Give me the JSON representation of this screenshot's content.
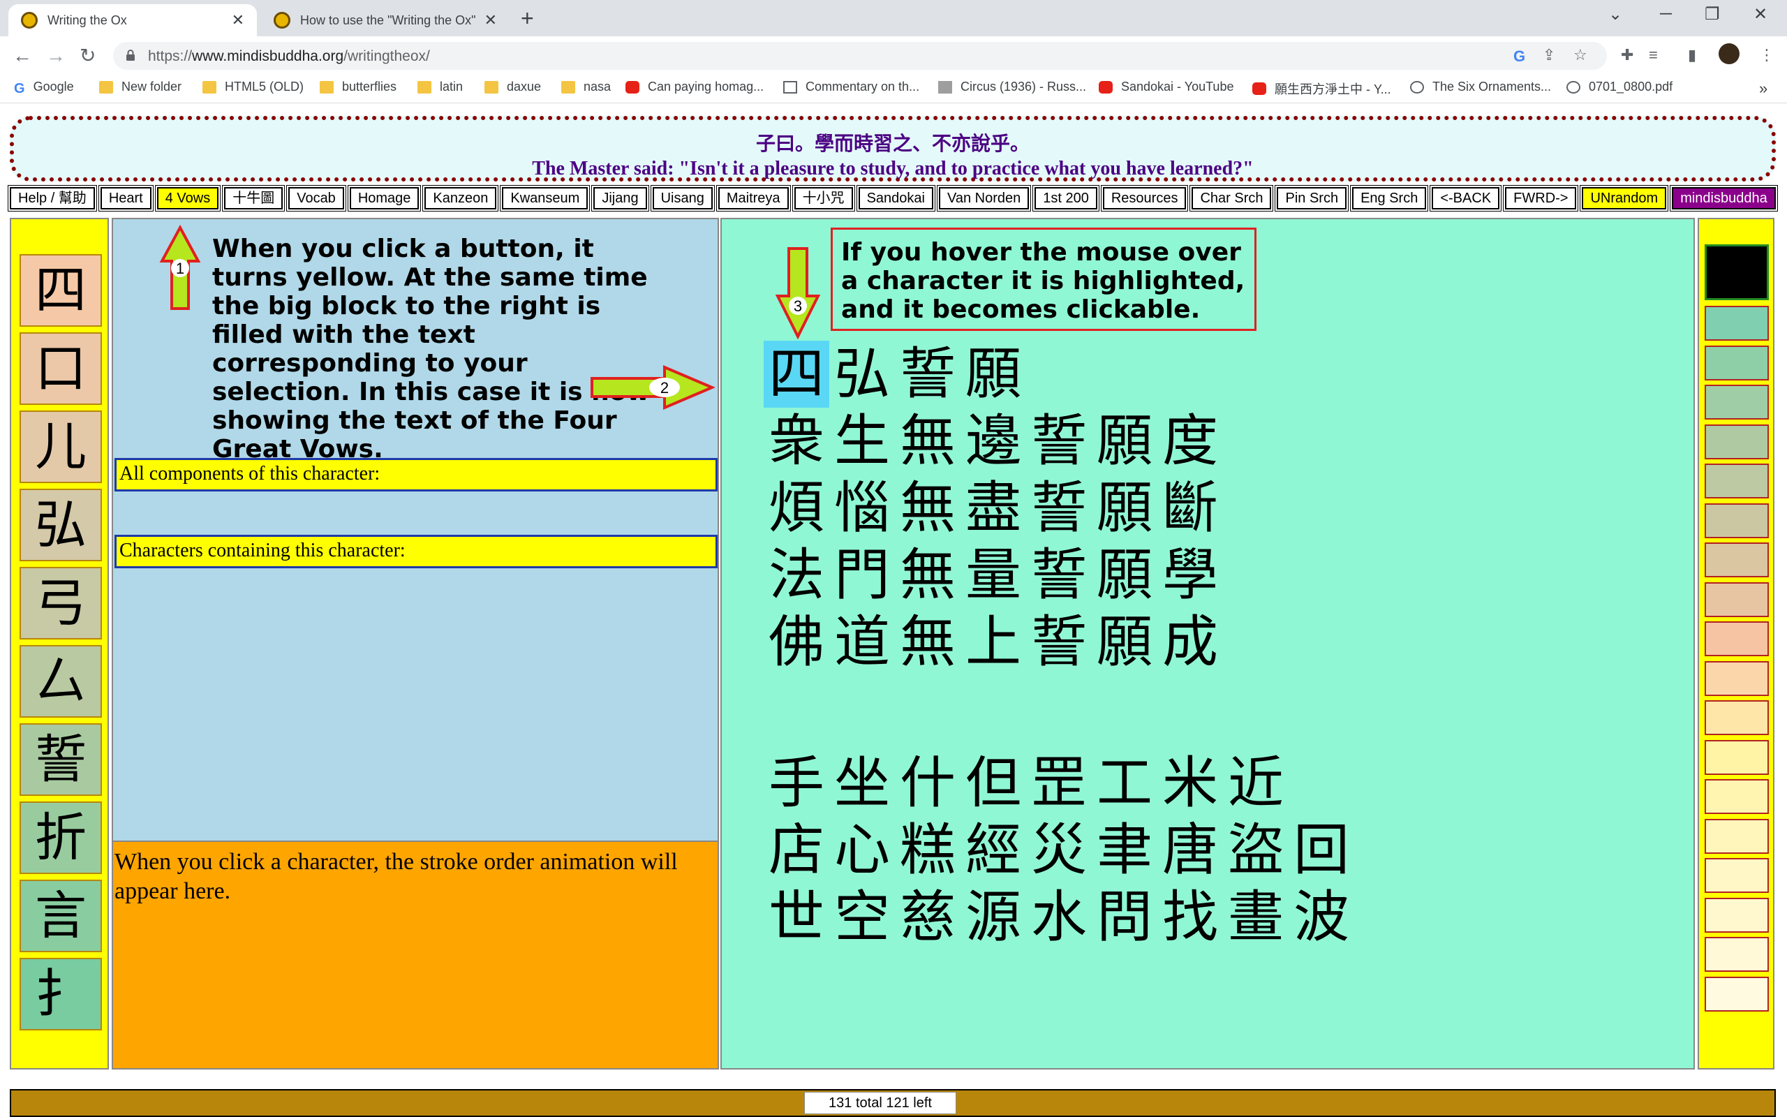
{
  "browser": {
    "tabs": [
      {
        "title": "Writing the Ox",
        "active": true
      },
      {
        "title": "How to use the \"Writing the Ox\"",
        "active": false
      }
    ],
    "url_prefix": "https://",
    "url_host": "www.mindisbuddha.org",
    "url_path": "/writingtheox/",
    "bookmarks": [
      {
        "label": "Google",
        "icon": "google-icon"
      },
      {
        "label": "New folder",
        "icon": "folder-icon"
      },
      {
        "label": "HTML5 (OLD)",
        "icon": "folder-icon"
      },
      {
        "label": "butterflies",
        "icon": "folder-icon"
      },
      {
        "label": "latin",
        "icon": "folder-icon"
      },
      {
        "label": "daxue",
        "icon": "folder-icon"
      },
      {
        "label": "nasa",
        "icon": "folder-icon"
      },
      {
        "label": "Can paying homag...",
        "icon": "youtube-icon"
      },
      {
        "label": "Commentary on th...",
        "icon": "page-icon"
      },
      {
        "label": "Circus (1936) - Russ...",
        "icon": "page-icon"
      },
      {
        "label": "Sandokai - YouTube",
        "icon": "youtube-icon"
      },
      {
        "label": "願生西方淨土中 - Y...",
        "icon": "youtube-icon"
      },
      {
        "label": "The Six Ornaments...",
        "icon": "globe-icon"
      },
      {
        "label": "0701_0800.pdf",
        "icon": "globe-icon"
      }
    ],
    "more_bookmarks": "»"
  },
  "quote": {
    "chinese": "子曰。學而時習之、不亦說乎。",
    "english": "The Master said: \"Isn't it a pleasure to study, and to practice what you have learned?\""
  },
  "buttons": [
    {
      "label": "Help / 幫助",
      "state": "normal"
    },
    {
      "label": "Heart",
      "state": "normal"
    },
    {
      "label": "4 Vows",
      "state": "selected"
    },
    {
      "label": "十牛圖",
      "state": "normal"
    },
    {
      "label": "Vocab",
      "state": "normal"
    },
    {
      "label": "Homage",
      "state": "normal"
    },
    {
      "label": "Kanzeon",
      "state": "normal"
    },
    {
      "label": "Kwanseum",
      "state": "normal"
    },
    {
      "label": "Jijang",
      "state": "normal"
    },
    {
      "label": "Uisang",
      "state": "normal"
    },
    {
      "label": "Maitreya",
      "state": "normal"
    },
    {
      "label": "十小咒",
      "state": "normal"
    },
    {
      "label": "Sandokai",
      "state": "normal"
    },
    {
      "label": "Van Norden",
      "state": "normal"
    },
    {
      "label": "1st 200",
      "state": "normal"
    },
    {
      "label": "Resources",
      "state": "normal"
    },
    {
      "label": "Char Srch",
      "state": "normal"
    },
    {
      "label": "Pin Srch",
      "state": "normal"
    },
    {
      "label": "Eng Srch",
      "state": "normal"
    },
    {
      "label": "<-BACK",
      "state": "normal"
    },
    {
      "label": "FWRD->",
      "state": "normal"
    },
    {
      "label": "UNrandom",
      "state": "selected"
    },
    {
      "label": "mindisbuddha",
      "state": "brand"
    }
  ],
  "left_strip": {
    "chars": [
      "四",
      "口",
      "儿",
      "弘",
      "弓",
      "厶",
      "誓",
      "折",
      "言",
      "扌"
    ],
    "colors": [
      "#f5c9a8",
      "#ecc8a8",
      "#e3c9a8",
      "#d4c9a8",
      "#c8c9a5",
      "#b9c9a2",
      "#a9caa0",
      "#98cc9f",
      "#88cc9f",
      "#78cca0"
    ]
  },
  "middle": {
    "instruction": "When you click a button, it turns yellow. At the same time the big block to the right is filled with the text corresponding to your selection. In this case it is now showing the text of the Four Great Vows.",
    "components_label": "All components of this character:",
    "containing_label": "Characters containing this character:",
    "stroke_text": "When you click a character, the stroke order animation will appear here."
  },
  "right": {
    "hover_note": "If you hover the mouse over a character it is highlighted, and it becomes clickable.",
    "vow_lines": [
      [
        "四",
        "弘",
        "誓",
        "願"
      ],
      [
        "衆",
        "生",
        "無",
        "邊",
        "誓",
        "願",
        "度"
      ],
      [
        "煩",
        "惱",
        "無",
        "盡",
        "誓",
        "願",
        "斷"
      ],
      [
        "法",
        "門",
        "無",
        "量",
        "誓",
        "願",
        "學"
      ],
      [
        "佛",
        "道",
        "無",
        "上",
        "誓",
        "願",
        "成"
      ]
    ],
    "extra_lines": [
      [
        "手",
        "坐",
        "什",
        "但",
        "罡",
        "工",
        "米",
        "近"
      ],
      [
        "店",
        "心",
        "糕",
        "經",
        "災",
        "聿",
        "唐",
        "盜",
        "回"
      ],
      [
        "世",
        "空",
        "慈",
        "源",
        "水",
        "問",
        "找",
        "畫",
        "波"
      ]
    ],
    "highlighted_char": "四"
  },
  "swatches": [
    "#000000",
    "#7fcfb0",
    "#8fcfa8",
    "#9fcda5",
    "#afcaa2",
    "#bdc9a2",
    "#cbc7a2",
    "#dbc6a2",
    "#e8c5a2",
    "#f6c4a3",
    "#fcd6ab",
    "#fde6a8",
    "#fff3a6",
    "#fff5b0",
    "#fff6bb",
    "#fff7c6",
    "#fff8cf",
    "#fff9d8",
    "#fffae0"
  ],
  "annotations": {
    "arrow1": "1",
    "arrow2": "2",
    "arrow3": "3"
  },
  "status": "131 total 121 left"
}
